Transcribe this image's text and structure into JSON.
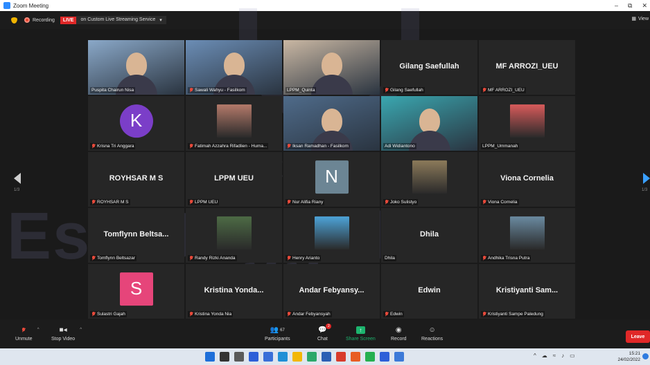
{
  "window": {
    "title": "Zoom Meeting",
    "minimize": "–",
    "restore": "⧉",
    "close": "✕"
  },
  "top_bar": {
    "recording_label": "Recording",
    "live_badge": "LIVE",
    "stream_label": "on Custom Live Streaming Service",
    "stream_caret": "▾",
    "view_label": "View",
    "view_icon": "grid-icon"
  },
  "watermark": {
    "line1": "Universitas",
    "line2": "Esa Unggul"
  },
  "navigation": {
    "left_page": "1/3",
    "right_page": "1/3"
  },
  "tiles": [
    {
      "label": "Puspita Chairun Nisa",
      "muted": false,
      "type": "video",
      "bg": "#8aa8c8"
    },
    {
      "label": "Sawali Wahyu - Fasilkom",
      "muted": true,
      "type": "video",
      "bg": "#6b8db5"
    },
    {
      "label": "LPPM_Quinta",
      "muted": false,
      "type": "video",
      "bg": "#c9b7a3"
    },
    {
      "label": "Gilang Saefullah",
      "muted": true,
      "type": "name",
      "display": "Gilang Saefullah"
    },
    {
      "label": "MF ARROZI_UEU",
      "muted": true,
      "type": "name",
      "display": "MF ARROZI_UEU"
    },
    {
      "label": "Krisna Tri Anggara",
      "muted": true,
      "type": "letter",
      "letter": "K",
      "avatar_color": "#7b3ec8"
    },
    {
      "label": "Fatimah Azzahra Rifadlien - Huma...",
      "muted": true,
      "type": "photo",
      "bg": "#b47a6a"
    },
    {
      "label": "Iksan Ramadhan - Fasilkom",
      "muted": true,
      "type": "video",
      "bg": "#4f6b8a"
    },
    {
      "label": "Adi Widiantono",
      "muted": false,
      "type": "video",
      "bg": "#3aa7b0",
      "active": true
    },
    {
      "label": "LPPM_Ummanah",
      "muted": false,
      "type": "photo",
      "bg": "#d85b5b"
    },
    {
      "label": "ROYHSAR M S",
      "muted": true,
      "type": "name",
      "display": "ROYHSAR M S"
    },
    {
      "label": "LPPM UEU",
      "muted": true,
      "type": "name",
      "display": "LPPM UEU"
    },
    {
      "label": "Nur Alifia Riany",
      "muted": true,
      "type": "letter",
      "letter": "N",
      "avatar_color": "#6c8594"
    },
    {
      "label": "Joko Sulistyo",
      "muted": true,
      "type": "photo",
      "bg": "#8c7a5a"
    },
    {
      "label": "Viona Cornelia",
      "muted": true,
      "type": "name",
      "display": "Viona Cornelia"
    },
    {
      "label": "Tomflynn Beltsazar",
      "muted": true,
      "type": "name",
      "display": "Tomflynn  Beltsa..."
    },
    {
      "label": "Randy Rizki Ananda",
      "muted": true,
      "type": "photo",
      "bg": "#4d6b45"
    },
    {
      "label": "Henry Arianto",
      "muted": true,
      "type": "photo",
      "bg": "#4da3d8"
    },
    {
      "label": "Dhila",
      "muted": false,
      "type": "name",
      "display": "Dhila"
    },
    {
      "label": "Andhika Trisna Putra",
      "muted": true,
      "type": "photo",
      "bg": "#6a8aa0"
    },
    {
      "label": "Sulastri Gajah",
      "muted": true,
      "type": "letter",
      "letter": "S",
      "avatar_color": "#e6457a"
    },
    {
      "label": "Kristina Yonda Nia",
      "muted": true,
      "type": "name",
      "display": "Kristina  Yonda..."
    },
    {
      "label": "Andar Febyansyah",
      "muted": true,
      "type": "name",
      "display": "Andar  Febyansy..."
    },
    {
      "label": "Edwin",
      "muted": true,
      "type": "name",
      "display": "Edwin"
    },
    {
      "label": "Kristiyanti Sampe Paledung",
      "muted": true,
      "type": "name",
      "display": "Kristiyanti  Sam..."
    }
  ],
  "controls": {
    "unmute": "Unmute",
    "stop_video": "Stop Video",
    "participants": "Participants",
    "participants_count": "67",
    "chat": "Chat",
    "chat_badge": "2",
    "share_screen": "Share Screen",
    "record": "Record",
    "reactions": "Reactions",
    "leave": "Leave"
  },
  "taskbar": {
    "time": "15:21",
    "date": "24/02/2022",
    "icon_colors": [
      "#1e6fd9",
      "#333333",
      "#5a5a5a",
      "#2d5fd8",
      "#3a6fd8",
      "#1f8fd6",
      "#f2b705",
      "#2ca86a",
      "#2b5fb4",
      "#d83b2b",
      "#e85d24",
      "#25b04f",
      "#2d5fd8",
      "#3d7ad8"
    ]
  }
}
